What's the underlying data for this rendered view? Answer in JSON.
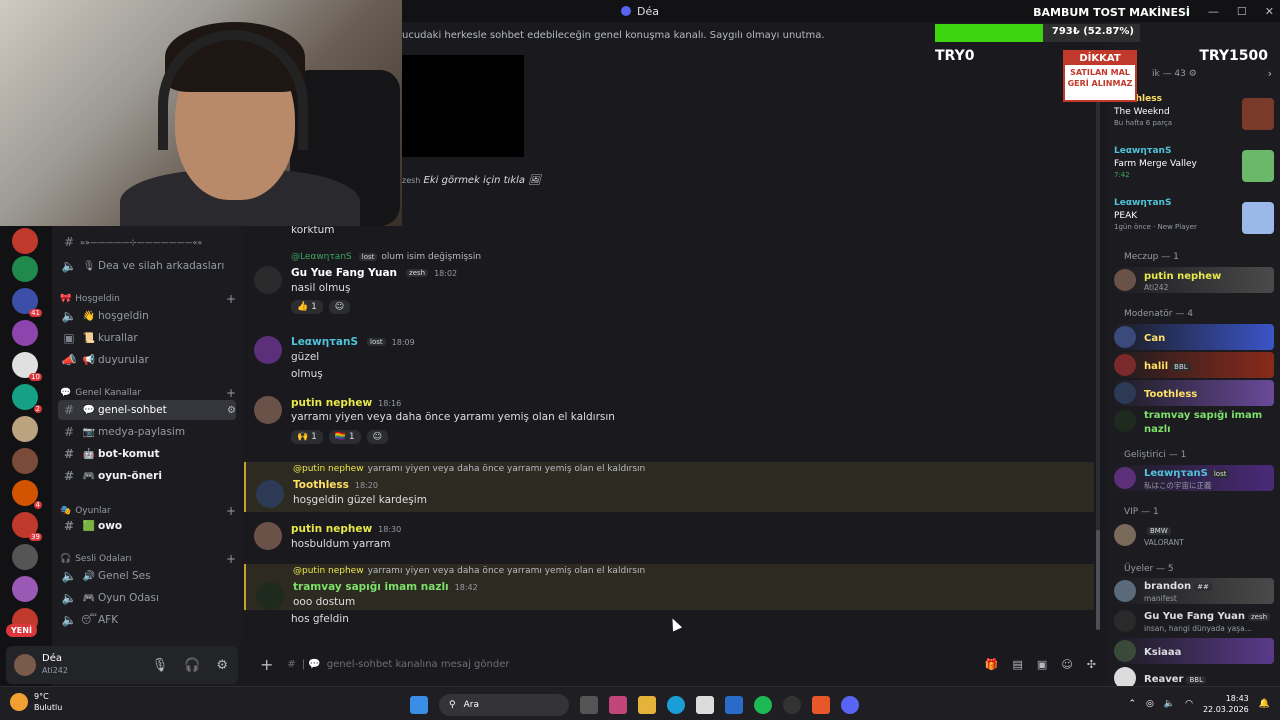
{
  "window": {
    "app_title": "Déa",
    "controls": [
      "⤓",
      "—",
      "☐",
      "✕"
    ]
  },
  "stream_overlay": {
    "title": "BAMBUM TOST MAKİNESİ",
    "progress_label": "793₺ (52.87%)",
    "progress_fraction": 0.5287,
    "low_label": "TRY0",
    "high_label": "TRY1500",
    "warning_title": "DİKKAT",
    "warning_text": "SATILAN MAL GERİ ALINMAZ"
  },
  "servers": {
    "badges": [
      "41",
      "10",
      "2",
      "4",
      "39"
    ],
    "new_label": "YENİ"
  },
  "channels": {
    "top_divider": "»»—————⊹———————««",
    "items": [
      {
        "name": "Dea ve silah arkadasları",
        "emoji": "🎙"
      },
      {
        "name": "hoşgeldin",
        "emoji": "👋"
      },
      {
        "name": "kurallar",
        "emoji": "📜"
      },
      {
        "name": "duyurular",
        "emoji": "📢"
      },
      {
        "name": "genel-sohbet",
        "emoji": "💬"
      },
      {
        "name": "medya-paylasim",
        "emoji": "📷"
      },
      {
        "name": "bot-komut",
        "emoji": "🤖"
      },
      {
        "name": "oyun-öneri",
        "emoji": "🎮"
      },
      {
        "name": "owo",
        "emoji": "🟩"
      },
      {
        "name": "Genel Ses",
        "emoji": "🔊"
      },
      {
        "name": "Oyun Odası",
        "emoji": "🎮"
      },
      {
        "name": "AFK",
        "emoji": "😴"
      }
    ],
    "categories": [
      "Hoşgeldin",
      "Genel Kanallar",
      "Oyunlar",
      "Sesli Odaları"
    ]
  },
  "user_panel": {
    "name": "Déa",
    "status": "Ati242"
  },
  "chat": {
    "topic": "ucudaki herkesle sohbet edebileceğin genel konuşma kanalı. Saygılı olmayı unutma.",
    "click_more": "Eki görmek için tıkla",
    "click_more_prefix": "zesh",
    "messages": [
      {
        "text": "korktum"
      },
      {
        "reply_to": "@LeαwητanS",
        "reply_tag": "lost",
        "reply_text": "olum isim değişmişsin",
        "author": "Gu Yue Fang Yuan",
        "author_tag": "zesh",
        "time": "18:02",
        "text": "nasil olmuş",
        "reactions": [
          "👍 1",
          "☺"
        ]
      },
      {
        "author": "LeαwητanS",
        "author_tag": "lost",
        "time": "18:09",
        "text": "güzel",
        "text2": "olmuş"
      },
      {
        "author": "putin nephew",
        "time": "18:16",
        "text": "yarramı yiyen veya daha önce yarramı yemiş olan el kaldırsın",
        "reactions": [
          "🙌 1",
          "🏳️‍🌈 1",
          "☺"
        ]
      },
      {
        "reply_to": "@putin nephew",
        "reply_text": "yarramı yiyen veya daha önce yarramı yemiş olan el kaldırsın",
        "author": "Toothless",
        "time": "18:20",
        "text": "hoşgeldin güzel kardeşim"
      },
      {
        "author": "putin nephew",
        "time": "18:30",
        "text": "hosbuldum yarram"
      },
      {
        "reply_to": "@putin nephew",
        "reply_text": "yarramı yiyen veya daha önce yarramı yemiş olan el kaldırsın",
        "author": "tramvay sapığı imam nazlı",
        "time": "18:42",
        "text": "ooo dostum",
        "text2": "hos gfeldin"
      }
    ],
    "composer_placeholder": "genel-sohbet kanalına mesaj gönder",
    "composer_prefix": "#"
  },
  "members": {
    "header": "ik — 43",
    "activities": [
      {
        "user": "Toothless",
        "game": "The Weeknd",
        "meta": "Bu hafta 6 parça"
      },
      {
        "user": "LeαwητanS",
        "game": "Farm Merge Valley",
        "meta": "7:42"
      },
      {
        "user": "LeαwητanS",
        "game": "PEAK",
        "meta": "1gün önce · New Player"
      }
    ],
    "groups": [
      {
        "title": "Meczup — 1"
      },
      {
        "title": "Modenatör — 4"
      },
      {
        "title": "Geliştirici — 1"
      },
      {
        "title": "VIP — 1"
      },
      {
        "title": "Üyeler — 5"
      }
    ],
    "list": [
      {
        "name": "putin nephew",
        "status": "Ati242",
        "color": "#e8e84a"
      },
      {
        "name": "Can",
        "status": "",
        "color": "#ffe066"
      },
      {
        "name": "halil",
        "tag": "BBL",
        "status": "",
        "color": "#ffe066"
      },
      {
        "name": "Toothless",
        "status": "",
        "color": "#ffe066"
      },
      {
        "name": "tramvay sapığı imam nazlı",
        "status": "",
        "color": "#7de06a"
      },
      {
        "name": "LeαwητanS",
        "tag": "lost",
        "status": "私はこの宇宙に正義",
        "color": "#4fc3d8"
      },
      {
        "name": "",
        "tag": "BMW",
        "status": "VALORANT",
        "color": "#5865f2"
      },
      {
        "name": "brandon",
        "tag": "##",
        "status": "manifest",
        "color": "#f2f3f5"
      },
      {
        "name": "Gu Yue Fang Yuan",
        "tag": "zesh",
        "status": "insan, hangi dünyada yaşa...",
        "color": "#f2f3f5"
      },
      {
        "name": "Ksiaaa",
        "status": "",
        "color": "#f2f3f5"
      },
      {
        "name": "Reaver",
        "tag": "BBL",
        "status": "",
        "color": "#f2f3f5"
      }
    ]
  },
  "taskbar": {
    "weather_temp": "9°C",
    "weather_desc": "Bulutlu",
    "search_label": "Ara",
    "time": "18:43",
    "date": "22.03.2026"
  }
}
